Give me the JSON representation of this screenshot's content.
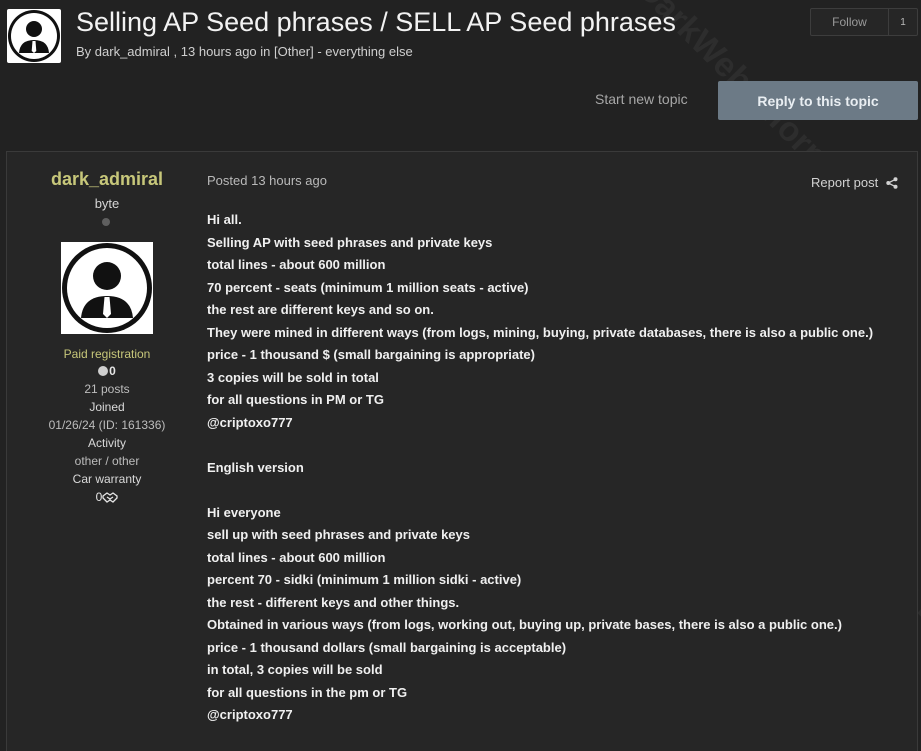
{
  "topic": {
    "title": "Selling AP Seed phrases / SELL AP Seed phrases",
    "meta": "By dark_admiral , 13 hours ago in [Other] - everything else"
  },
  "actions": {
    "follow_label": "Follow",
    "follow_count": "1",
    "start_new_topic": "Start new topic",
    "reply": "Reply to this topic"
  },
  "post": {
    "author": {
      "name": "dark_admiral",
      "rank": "byte",
      "group": "Paid registration",
      "reputation": "0",
      "posts": "21 posts",
      "joined_label": "Joined",
      "joined_value": "01/26/24 (ID: 161336)",
      "activity_label": "Activity",
      "activity_value": "other / other",
      "warranty_label": "Car warranty",
      "warranty_value": "0"
    },
    "posted": "Posted 13 hours ago",
    "report": "Report post",
    "body": [
      "Hi all.",
      "Selling AP with seed phrases and private keys",
      "total lines - about 600 million",
      "70 percent - seats (minimum 1 million seats - active)",
      "the rest are different keys and so on.",
      "They were mined in different ways (from logs, mining, buying, private databases, there is also a public one.)",
      "price - 1 thousand $ (small bargaining is appropriate)",
      "3 copies will be sold in total",
      "for all questions in PM or TG",
      "@criptoxo777",
      "",
      "English version",
      "",
      "Hi everyone",
      "sell up with seed phrases and private keys",
      "total lines - about 600 million",
      "percent 70 - sidki (minimum 1 million sidki - active)",
      "the rest - different keys and other things.",
      "Obtained in various ways (from logs, working out, buying up, private bases, there is also a public one.)",
      "price - 1 thousand dollars (small bargaining is acceptable)",
      "in total, 3 copies will be sold",
      "for all questions in the pm or TG",
      "@criptoxo777"
    ]
  },
  "watermark": "DarkWeb Informer",
  "icons": {
    "avatar": "user-silhouette-icon",
    "share": "share-icon",
    "handshake": "handshake-icon"
  }
}
